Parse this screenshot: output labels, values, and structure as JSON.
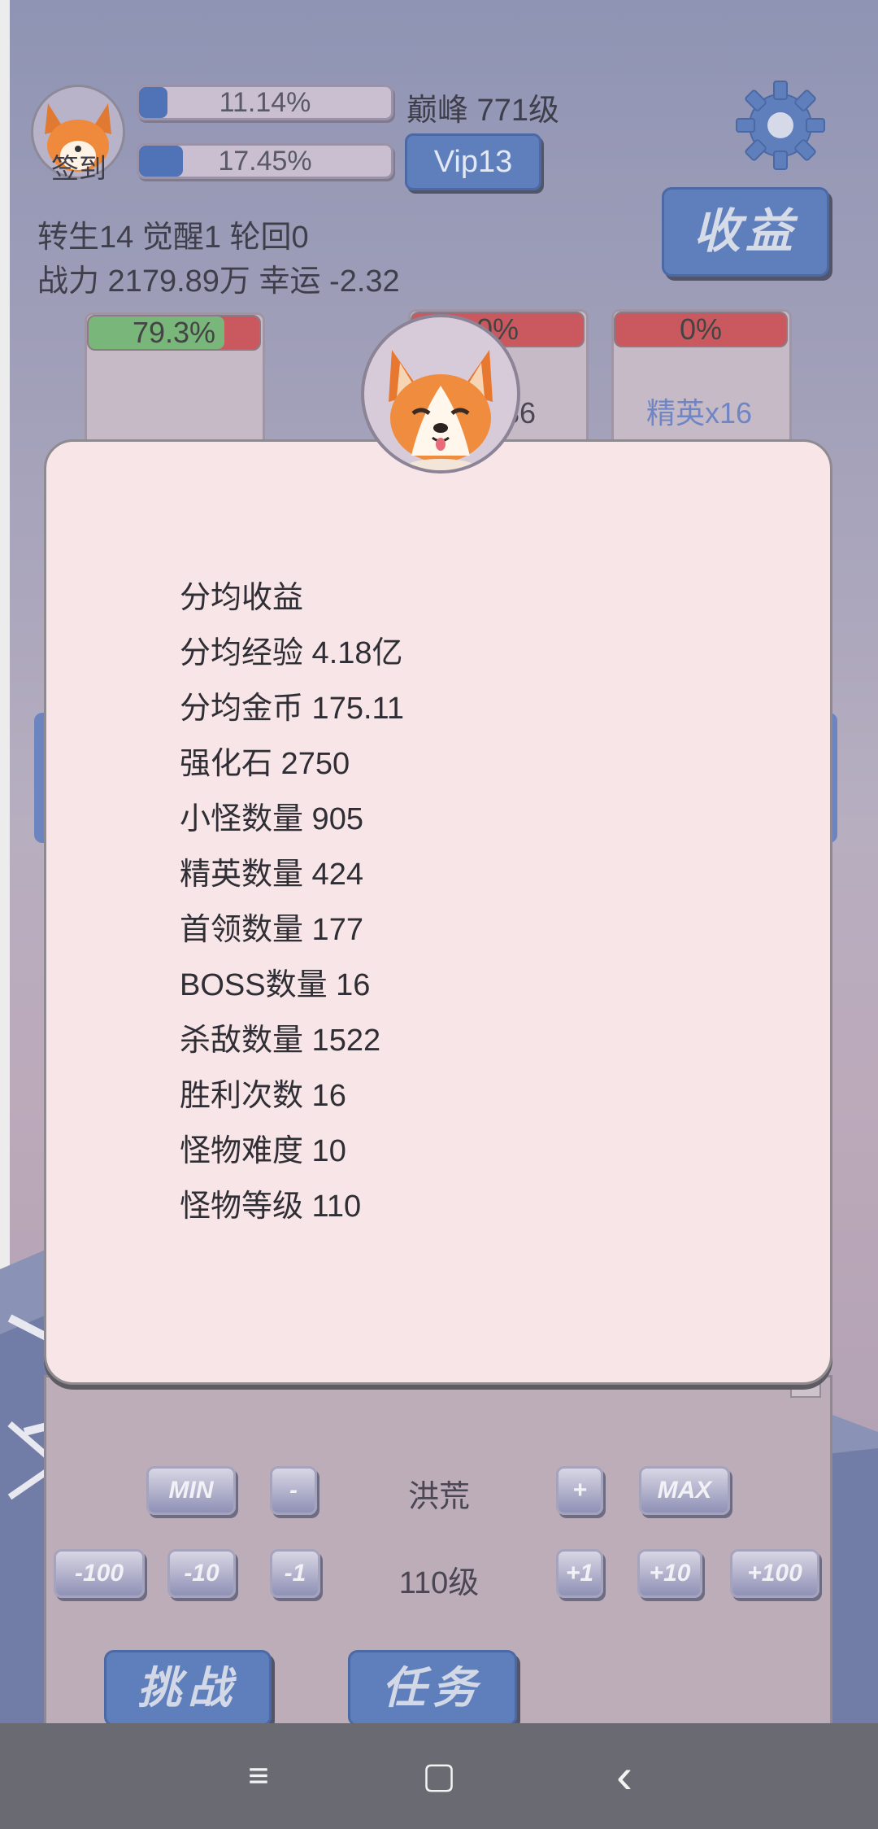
{
  "header": {
    "avatar_label": "签到",
    "exp_bar": {
      "percent_text": "11.14%",
      "fill": 0.1114
    },
    "second_bar": {
      "percent_text": "17.45%",
      "fill": 0.1745
    },
    "level_text": "巅峰 771级",
    "vip_label": "Vip13",
    "income_button": "收益",
    "line1": "转生14 觉醒1 轮回0",
    "line2": "战力 2179.89万  幸运 -2.32"
  },
  "cards": [
    {
      "bar_text": "79.3%",
      "bar_fill": 0.793,
      "label": ""
    },
    {
      "bar_text": "0%",
      "bar_fill": 0,
      "label": "怪x36"
    },
    {
      "bar_text": "0%",
      "bar_fill": 0,
      "label": "精英x16"
    }
  ],
  "modal": {
    "lines": [
      "分均收益",
      "分均经验 4.18亿",
      "分均金币 175.11",
      "强化石  2750",
      "小怪数量 905",
      "精英数量 424",
      "首领数量 177",
      "BOSS数量 16",
      "杀敌数量  1522",
      "胜利次数  16",
      "怪物难度  10",
      "怪物等级  110"
    ]
  },
  "controls": {
    "row1": {
      "min": "MIN",
      "minus": "-",
      "center": "洪荒",
      "plus": "+",
      "max": "MAX"
    },
    "row2": {
      "m100": "-100",
      "m10": "-10",
      "m1": "-1",
      "center": "110级",
      "p1": "+1",
      "p10": "+10",
      "p100": "+100"
    },
    "challenge": "挑战",
    "task": "任务"
  },
  "navbar": {
    "menu_icon": "≡",
    "home_icon": "▢",
    "back_icon": "‹"
  },
  "colors": {
    "accent": "#5f7fbc",
    "modal_bg": "#f8e5e8",
    "green": "#6fae6f",
    "red": "#c9595e"
  }
}
